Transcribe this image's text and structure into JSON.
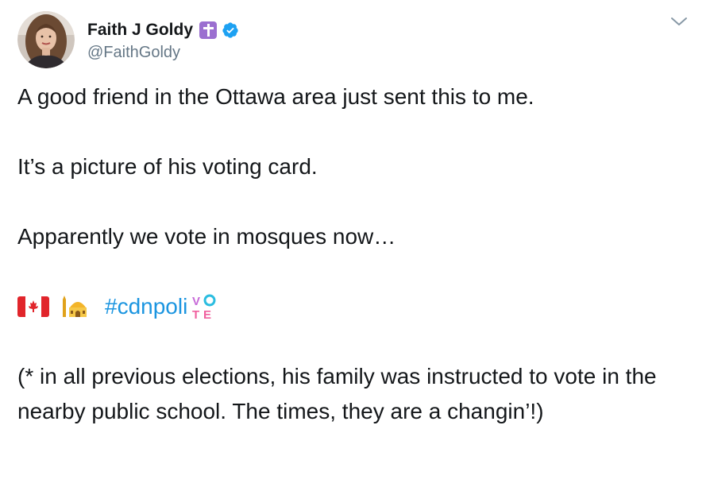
{
  "author": {
    "display_name": "Faith J Goldy",
    "handle": "@FaithGoldy",
    "avatar_icon": "avatar-photo",
    "badge_icon": "latin-cross-icon",
    "verified_icon": "verified-badge-icon",
    "verified_color": "#1da1f2"
  },
  "menu": {
    "icon": "chevron-down-icon"
  },
  "tweet": {
    "line1": "A good friend in the Ottawa area just sent this to me.",
    "line2": "It’s a picture of his voting card.",
    "line3": "Apparently we vote in mosques now…",
    "emoji": {
      "flag_icon": "canada-flag-icon",
      "mosque_icon": "mosque-icon",
      "vote_icon": "vote-icon"
    },
    "hashtag": "#cdnpoli",
    "hashtag_color": "#1b95e0",
    "line4": "(* in all previous elections, his family was instructed to vote in the nearby public school. The times, they are a changin’!)"
  }
}
